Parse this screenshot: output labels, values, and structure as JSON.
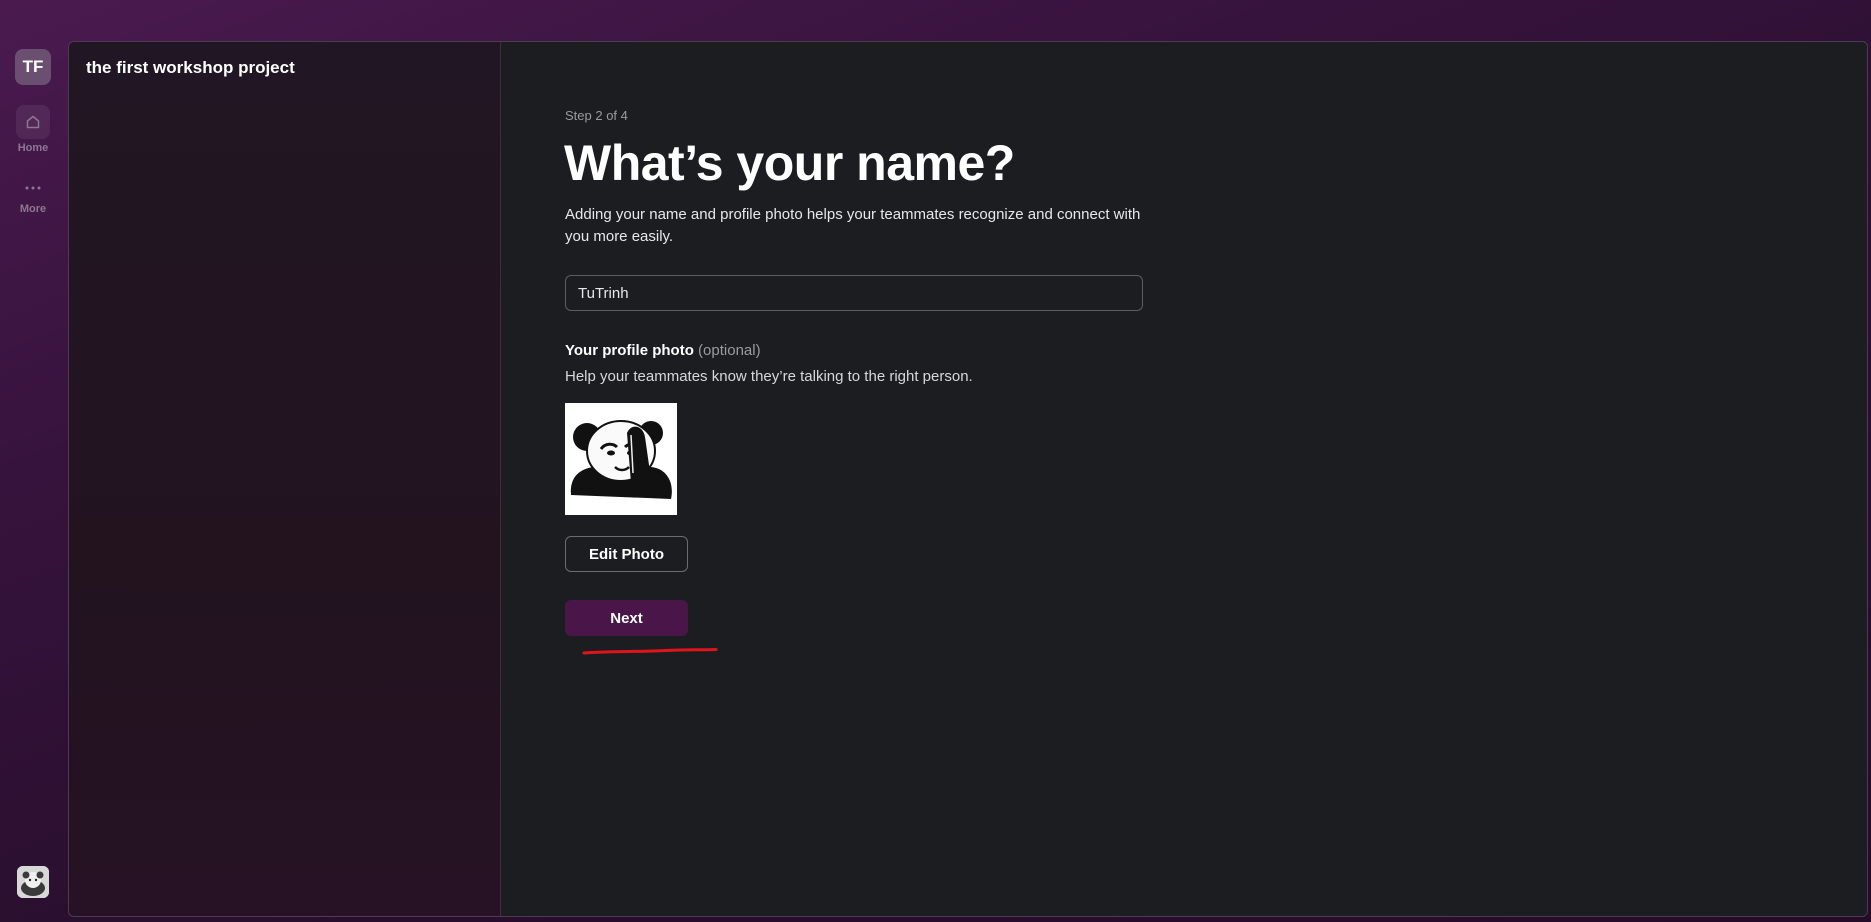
{
  "workspace": {
    "initials": "TF",
    "name": "the first workshop project"
  },
  "rail": {
    "home_label": "Home",
    "more_label": "More"
  },
  "onboarding": {
    "step": "Step 2 of 4",
    "title": "What’s your name?",
    "description": "Adding your name and profile photo helps your teammates recognize and connect with you more easily.",
    "name_value": "TuTrinh",
    "photo_label": "Your profile photo",
    "photo_optional": "(optional)",
    "photo_help": "Help your teammates know they’re talking to the right person.",
    "edit_photo_label": "Edit Photo",
    "next_label": "Next"
  },
  "colors": {
    "accent": "#4a1649",
    "annotation": "#e0151b"
  }
}
